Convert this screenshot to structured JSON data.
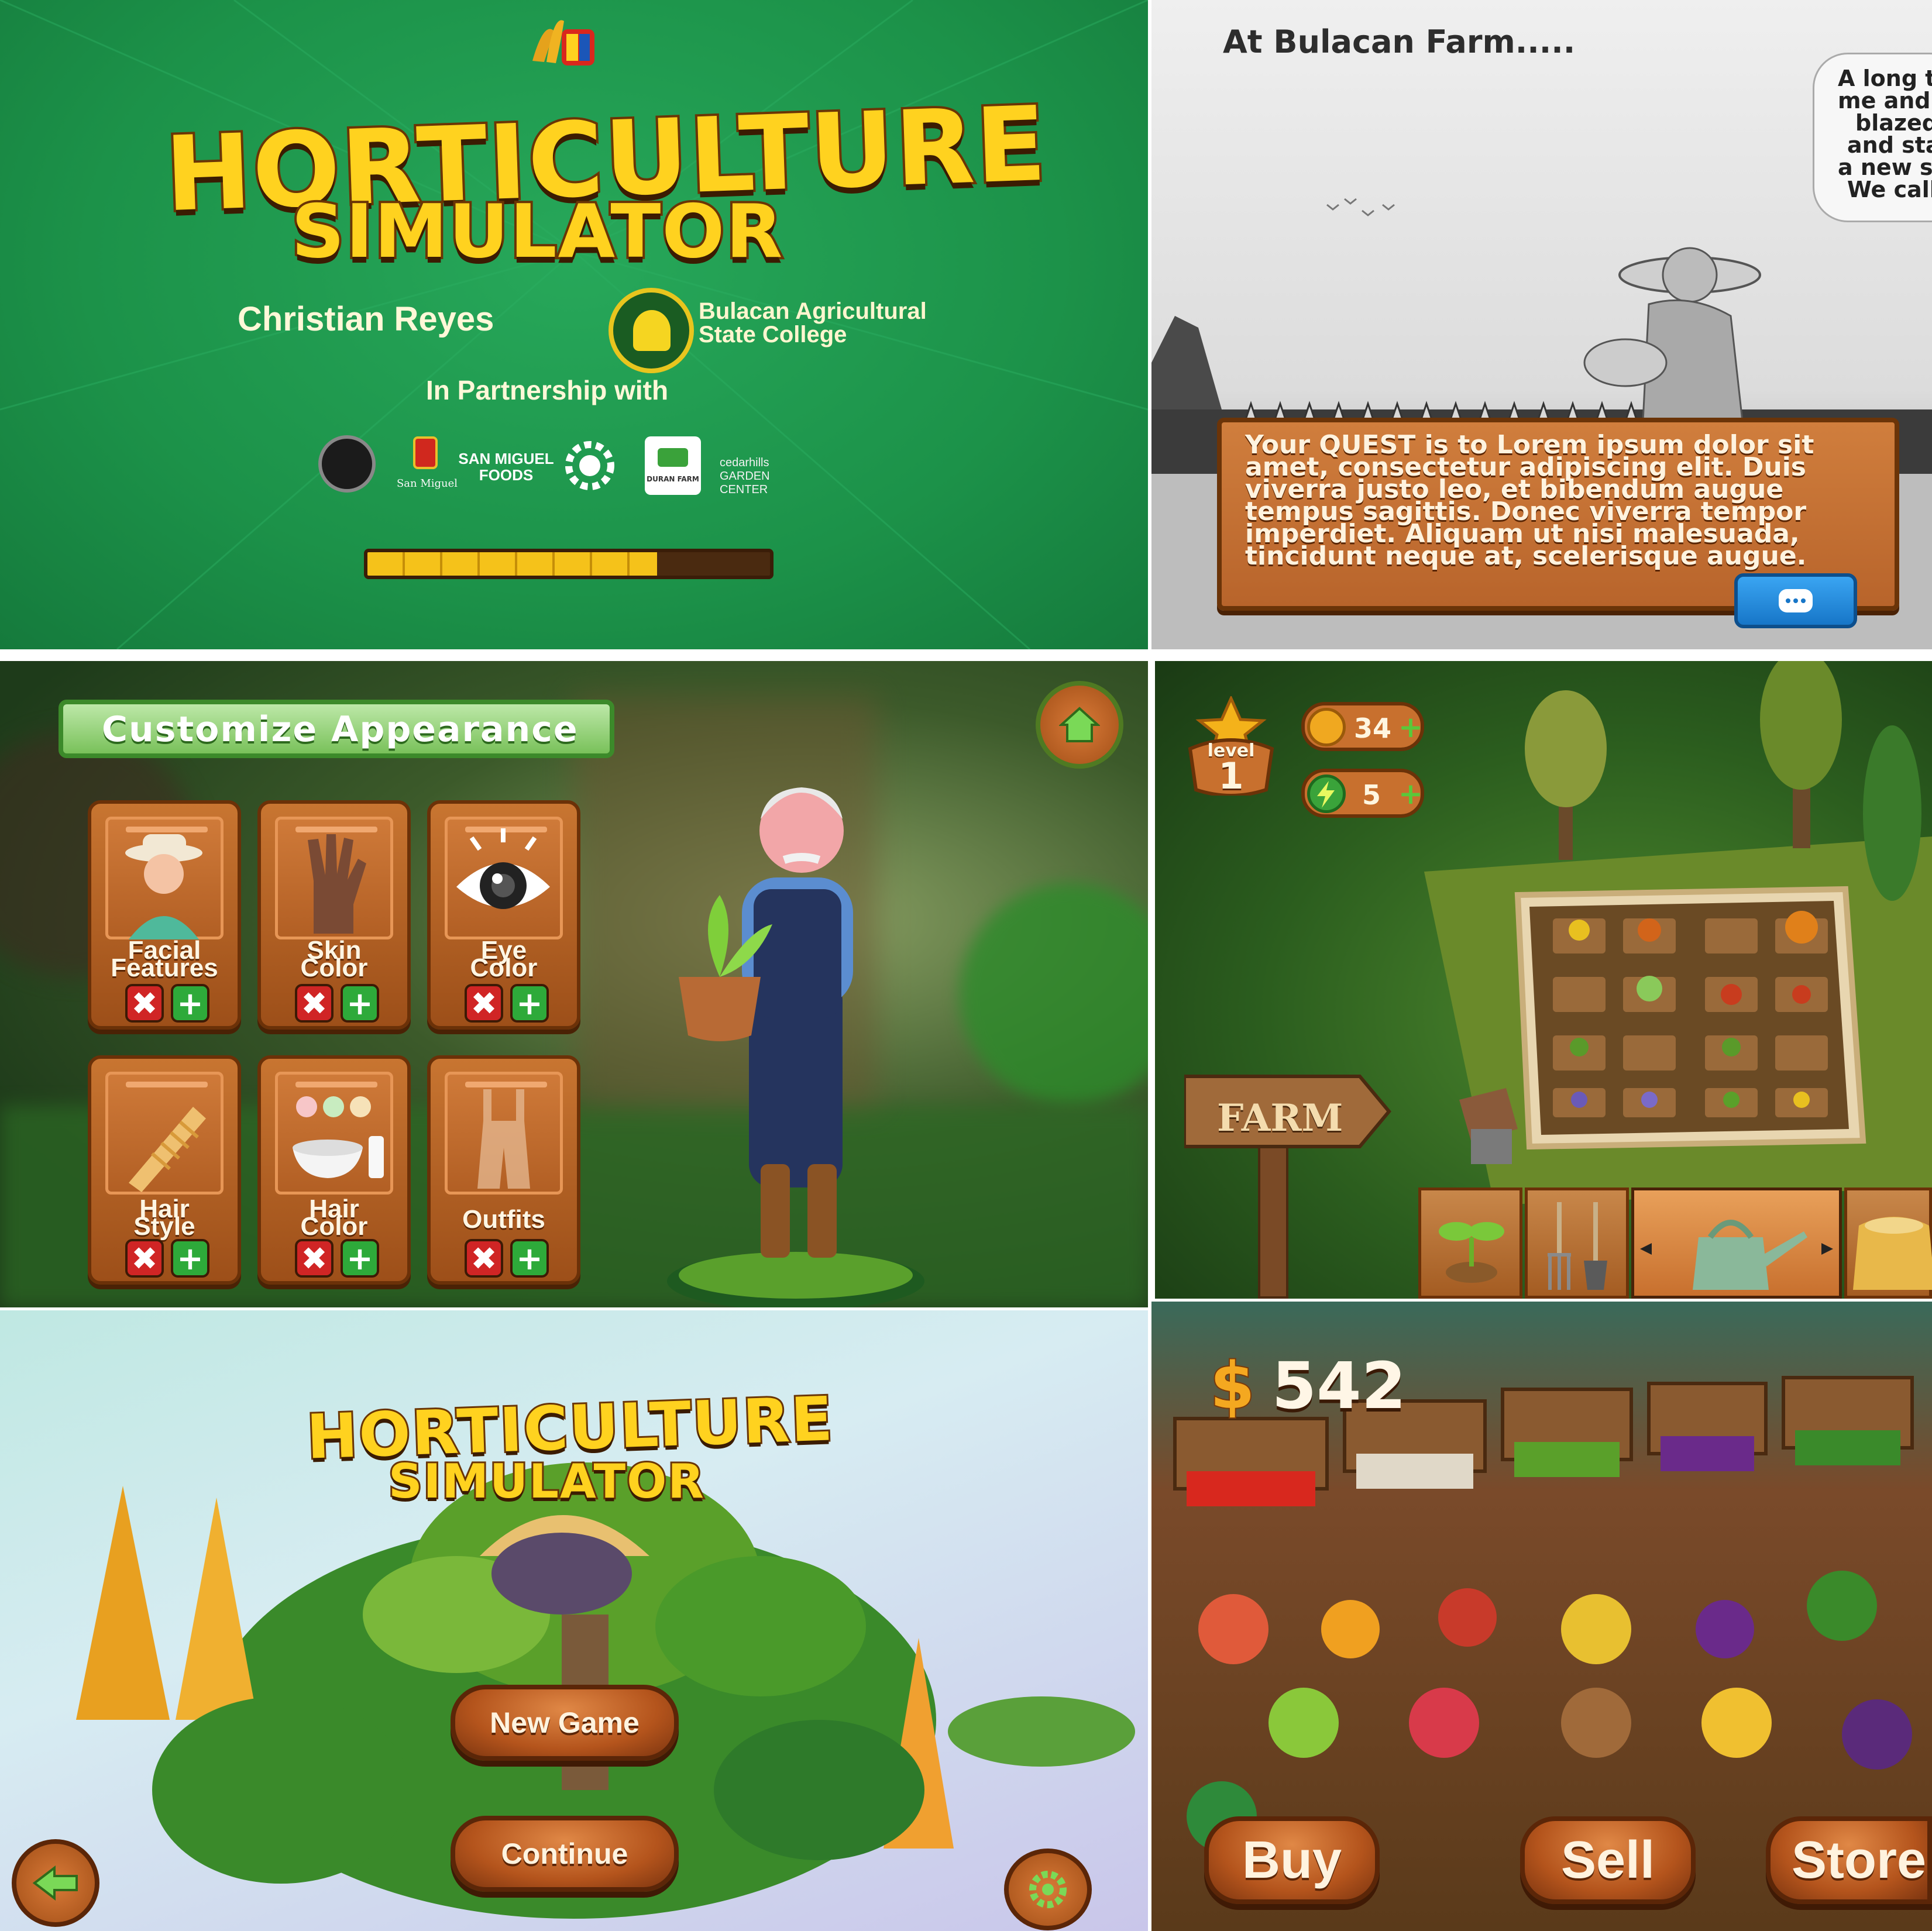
{
  "panel1": {
    "title_line1": "HORTICULTURE",
    "title_line2": "SIMULATOR",
    "author": "Christian Reyes",
    "college": "Bulacan Agricultural State College",
    "college_line1": "Bulacan Agricultural",
    "college_line2": "State College",
    "partnership": "In Partnership with",
    "partner_labels": [
      "San Miguel",
      "SAN MIGUEL FOODS",
      "DURAN FARM",
      "cedarhills GARDEN CENTER"
    ],
    "loading_progress": 0.72,
    "loading_segments": 8,
    "colors": {
      "background": "#1f9a4f",
      "title": "#ffd21f",
      "progress_fill": "#f5c21a",
      "progress_track": "#4a2a10"
    }
  },
  "panel2": {
    "heading": "At Bulacan Farm.....",
    "speech_lines": [
      "A long t",
      "me and r",
      "blazed",
      "and sta",
      "a new se",
      "We call"
    ],
    "quest_text": "Your QUEST is to Lorem ipsum dolor sit amet, consectetur adipiscing elit. Duis viverra justo leo, et bibendum augue tempus sagittis. Donec viverra tempor imperdiet. Aliquam ut nisi malesuada, tincidunt neque at, scelerisque augue.",
    "dialog_icon": "speech-bubble-icon"
  },
  "panel3": {
    "header": "Customize Appearance",
    "cards": [
      {
        "label_line1": "Facial",
        "label_line2": "Features",
        "icon": "farmer-face-icon",
        "has_buttons": true
      },
      {
        "label_line1": "Skin",
        "label_line2": "Color",
        "icon": "glove-hand-icon",
        "has_buttons": true
      },
      {
        "label_line1": "Eye",
        "label_line2": "Color",
        "icon": "eye-icon",
        "has_buttons": true
      },
      {
        "label_line1": "Hair",
        "label_line2": "Style",
        "icon": "comb-icon",
        "has_buttons": true
      },
      {
        "label_line1": "Hair",
        "label_line2": "Color",
        "icon": "dye-bowl-icon",
        "has_buttons": true
      },
      {
        "label_line1": "Outfits",
        "label_line2": "",
        "icon": "overalls-icon",
        "has_buttons": true
      }
    ],
    "remove_symbol": "✖",
    "add_symbol": "+",
    "home_icon": "home-icon"
  },
  "panel4": {
    "level_label": "level",
    "level_value": "1",
    "coins": "34",
    "energy": "5",
    "plus_symbol": "+",
    "sign_text": "FARM",
    "tools": [
      "sprout-icon",
      "fork-and-shovel-icon",
      "watering-can-icon",
      "seed-sack-icon"
    ],
    "selected_tool": 2
  },
  "panel5": {
    "title_line1": "HORTICULTURE",
    "title_line2": "SIMULATOR",
    "new_game": "New Game",
    "continue": "Continue",
    "back_icon": "back-arrow-icon",
    "settings_icon": "gear-icon"
  },
  "panel6": {
    "currency_symbol": "$",
    "money": "542",
    "buy": "Buy",
    "sell": "Sell",
    "store": "Store"
  }
}
